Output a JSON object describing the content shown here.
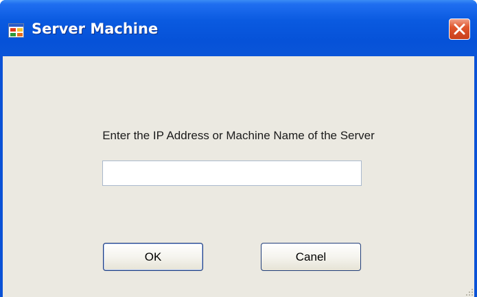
{
  "window": {
    "title": "Server Machine",
    "icon": "app-window-icon",
    "close_icon": "close-icon"
  },
  "dialog": {
    "prompt": "Enter the IP Address or Machine Name of the Server",
    "input_value": "",
    "ok_label": "OK",
    "cancel_label": "Canel"
  },
  "colors": {
    "titlebar": "#0a55d8",
    "client_background": "#ebe9e1",
    "close_button": "#e0562e"
  }
}
